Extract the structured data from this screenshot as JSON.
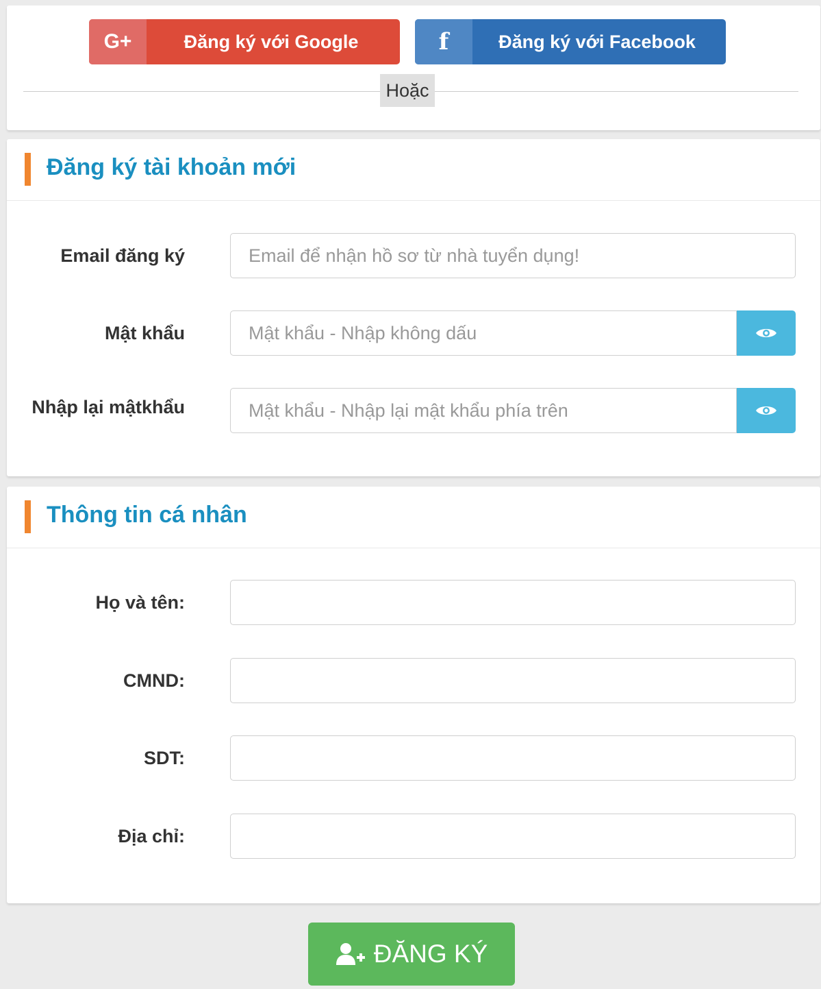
{
  "social": {
    "google_icon": "G+",
    "google_label": "Đăng ký với Google",
    "facebook_icon": "f",
    "facebook_label": "Đăng ký với Facebook",
    "divider_text": "Hoặc",
    "google_color": "#dd4b39",
    "facebook_color": "#2f6fb5"
  },
  "account": {
    "title": "Đăng ký tài khoản mới",
    "email_label": "Email đăng ký",
    "email_placeholder": "Email để nhận hồ sơ từ nhà tuyển dụng!",
    "password_label": "Mật khẩu",
    "password_placeholder": "Mật khẩu - Nhập không dấu",
    "confirm_label_line1": "Nhập lại mật",
    "confirm_label_line2": "khẩu",
    "confirm_placeholder": "Mật khẩu - Nhập lại mật khẩu phía trên",
    "eye_icon": "eye-icon"
  },
  "personal": {
    "title": "Thông tin cá nhân",
    "fullname_label": "Họ và tên:",
    "id_label": "CMND:",
    "phone_label": "SDT:",
    "address_label": "Địa chỉ:"
  },
  "submit": {
    "label": "ĐĂNG KÝ",
    "icon": "add-user-icon",
    "color": "#5cb85c"
  },
  "colors": {
    "accent": "#f0862f",
    "title": "#1a8fc0",
    "eye_button": "#4bb8de"
  }
}
